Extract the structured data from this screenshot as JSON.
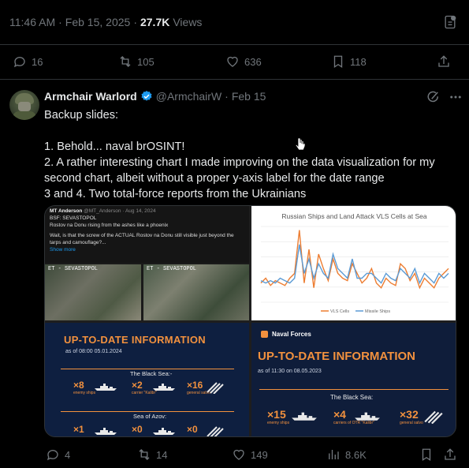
{
  "main_tweet": {
    "time": "11:46 AM",
    "date_sep": "·",
    "date": "Feb 15, 2025",
    "date_views_sep": "·",
    "views_count": "27.7K",
    "views_label": "Views",
    "actions": {
      "replies": "16",
      "reposts": "105",
      "likes": "636",
      "bookmarks": "118"
    }
  },
  "reply_tweet": {
    "display_name": "Armchair Warlord",
    "handle": "@ArmchairW",
    "sep": "·",
    "date": "Feb 15",
    "lines": [
      "Backup slides:",
      "",
      "1. Behold... naval brOSINT!",
      "2. A rather interesting chart I made improving on the data visualization for my second chart, albeit without a proper y-axis label for the date range",
      "3 and 4. Two total-force reports from the Ukrainians"
    ],
    "media": {
      "img1": {
        "author": "MT Anderson",
        "author_handle": "@MT_Anderson · Aug 14, 2024",
        "subtitle": "BSF: SEVASTOPOL",
        "line1": "Rostov na Donu rising from the ashes like a phoenix",
        "line2": "Wait, is that the screw of the ACTUAL Rostov na Donu still visible just beyond the tarps and camouflage?...",
        "show_more": "Show more",
        "sat_label_1": "ET - SEVASTOPOL",
        "sat_label_2": "ET - SEVASTOPOL"
      },
      "img2": {
        "title": "Russian Ships and Land Attack VLS Cells at Sea",
        "legend_vls": "VLS Cells",
        "legend_ships": "Missile Ships"
      },
      "img3": {
        "title": "UP-TO-DATE INFORMATION",
        "date": "as of 08:00 05.01.2024",
        "black_sea": "The Black Sea:-",
        "azov": "Sea of Azov:",
        "stats": [
          {
            "n": "×8",
            "l": "enemy ships"
          },
          {
            "n": "×2",
            "l": "carrier \"Kalibr\""
          },
          {
            "n": "×16",
            "l": "general salvo"
          },
          {
            "n": "×1",
            "l": ""
          },
          {
            "n": "×0",
            "l": ""
          },
          {
            "n": "×0",
            "l": ""
          }
        ]
      },
      "img4": {
        "badge": "Naval Forces",
        "title": "UP-TO-DATE INFORMATION",
        "date": "as of 11:30 on 08.05.2023",
        "black_sea": "The Black Sea:",
        "stats": [
          {
            "n": "×15",
            "l": "enemy ships"
          },
          {
            "n": "×4",
            "l": "carriers of OTR \"Kalibr\""
          },
          {
            "n": "×32",
            "l": "general salvo"
          }
        ]
      }
    },
    "actions": {
      "replies": "4",
      "reposts": "14",
      "likes": "149",
      "views": "8.6K"
    }
  },
  "colors": {
    "background": "#000000",
    "text": "#e7e9ea",
    "muted": "#71767b",
    "verified": "#1d9bf0",
    "accent_orange": "#f2913e",
    "chart_blue": "#5b9bd5",
    "chart_orange": "#ed7d31"
  },
  "icons": [
    "grok-icon",
    "more-icon",
    "verified-badge-icon",
    "reply-icon",
    "repost-icon",
    "like-icon",
    "bookmark-icon",
    "share-icon",
    "views-icon",
    "cursor-icon"
  ],
  "chart_data": {
    "type": "line",
    "title": "Russian Ships and Land Attack VLS Cells at Sea",
    "xlabel": "",
    "ylabel": "",
    "x": [
      1,
      2,
      3,
      4,
      5,
      6,
      7,
      8,
      9,
      10,
      11,
      12,
      13,
      14,
      15,
      16,
      17,
      18,
      19,
      20,
      21,
      22,
      23,
      24,
      25,
      26,
      27,
      28,
      29,
      30,
      31,
      32,
      33,
      34,
      35,
      36,
      37,
      38,
      39,
      40
    ],
    "series": [
      {
        "name": "VLS Cells",
        "values": [
          8,
          10,
          7,
          9,
          8,
          7,
          10,
          12,
          30,
          8,
          22,
          6,
          20,
          14,
          9,
          18,
          12,
          10,
          9,
          16,
          12,
          8,
          10,
          14,
          8,
          6,
          10,
          8,
          7,
          16,
          14,
          9,
          12,
          6,
          10,
          8,
          6,
          10,
          12,
          14
        ]
      },
      {
        "name": "Missile Ships",
        "values": [
          9,
          8,
          9,
          8,
          10,
          9,
          8,
          10,
          24,
          12,
          18,
          10,
          16,
          12,
          10,
          20,
          14,
          12,
          10,
          18,
          10,
          10,
          12,
          12,
          10,
          8,
          12,
          10,
          9,
          14,
          12,
          10,
          14,
          8,
          12,
          10,
          8,
          12,
          10,
          12
        ]
      }
    ]
  }
}
